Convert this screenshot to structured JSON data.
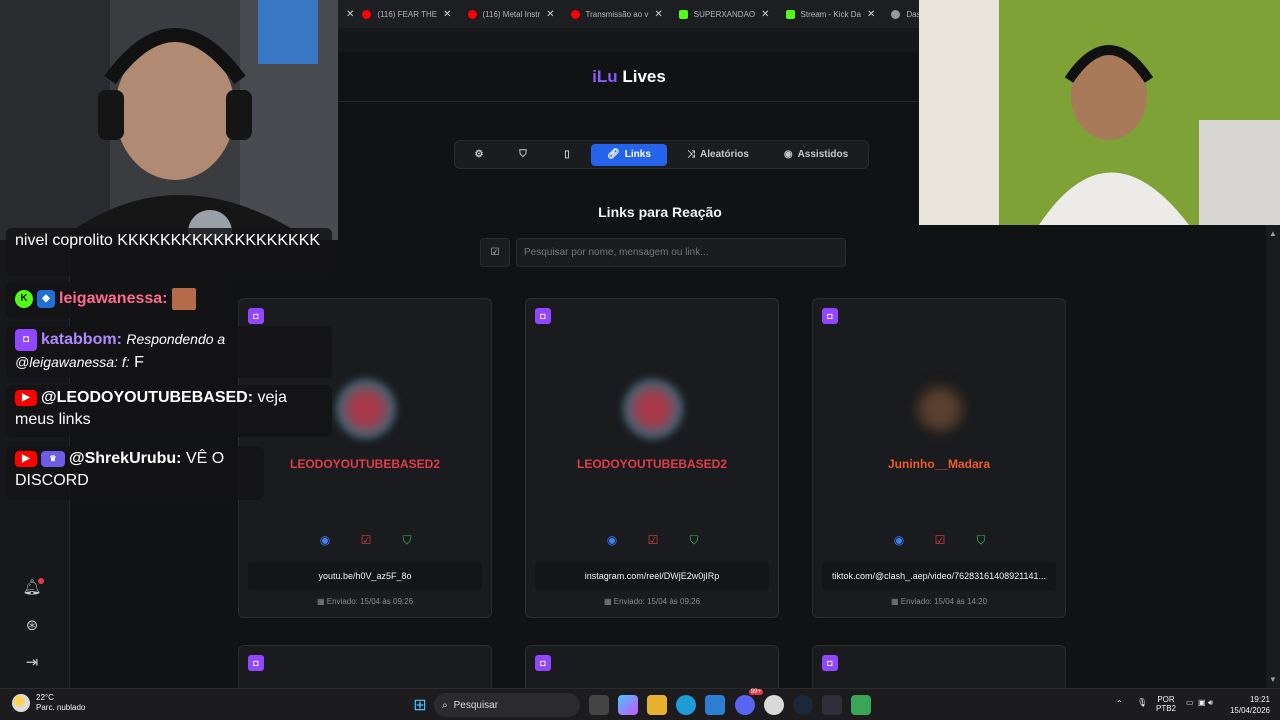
{
  "browser": {
    "tabs": [
      {
        "title": "(116) FEAR THE",
        "color": "#ff0000"
      },
      {
        "title": "(116) Metal Instr",
        "color": "#ff0000"
      },
      {
        "title": "Transmissão ao v",
        "color": "#ff0000"
      },
      {
        "title": "SUPERXANDAO",
        "color": "#53fc18"
      },
      {
        "title": "Stream - Kick Da",
        "color": "#53fc18"
      },
      {
        "title": "Dashboard - L",
        "color": "#9a9a9a"
      }
    ]
  },
  "dashboard": {
    "brand_accent": "iLu",
    "brand_rest": "Lives",
    "nav": {
      "settings_icon": "gear-icon",
      "shield_icon": "shield-icon",
      "tablet_icon": "tablet-icon",
      "links_label": "Links",
      "random_label": "Aleatórios",
      "watched_label": "Assistidos"
    },
    "section_title": "Links para Reação",
    "search_placeholder": "Pesquisar por nome, mensagem ou link...",
    "cards": [
      {
        "name": "LEODOYOUTUBEBASED2",
        "link": "youtu.be/h0V_az5F_8o",
        "date": "Enviado: 15/04 às 09:26",
        "avatar_color": "#7a2b3a"
      },
      {
        "name": "LEODOYOUTUBEBASED2",
        "link": "instagram.com/reel/DWjE2w0jIRp",
        "date": "Enviado: 15/04 às 09:26",
        "avatar_color": "#7a2b3a"
      },
      {
        "name": "Juninho__Madara",
        "link": "tiktok.com/@clash_.aep/video/76283161408921141...",
        "date": "Enviado: 15/04 às 14:20",
        "avatar_color": "#3a2a25"
      }
    ]
  },
  "chat": {
    "msg1_text": "nivel coprolito KKKKKKKKKKKKKKKKKKK",
    "msg2_user": "leigawanessa:",
    "msg3_user": "katabbom:",
    "msg3_text": "Respondendo a @leigawanessa: f:",
    "msg3_tail": "F",
    "msg4_user": "@LEODOYOUTUBEBASED:",
    "msg4_text": "veja meus links",
    "msg5_user": "@ShrekUrubu:",
    "msg5_text": "VÊ O DISCORD"
  },
  "taskbar": {
    "temp": "22°C",
    "weather": "Parc. nublado",
    "search_label": "Pesquisar",
    "lang1": "POR",
    "lang2": "PTB2",
    "time": "19:21",
    "date": "15/04/2026",
    "badge_count": "99+"
  }
}
